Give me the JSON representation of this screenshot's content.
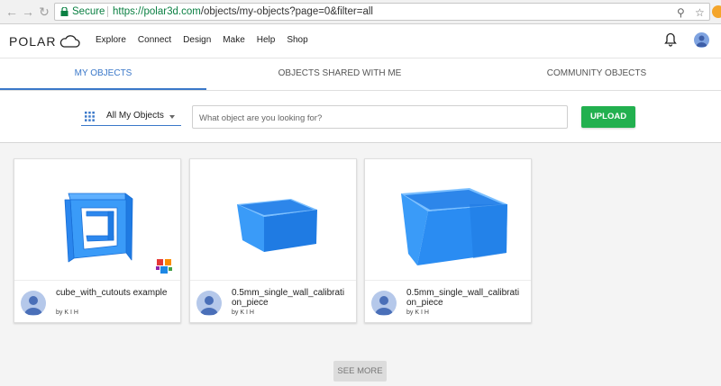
{
  "browser": {
    "secure_label": "Secure",
    "url_host": "https://polar3d.com",
    "url_path": "/objects/my-objects?page=0&filter=all"
  },
  "header": {
    "logo_text": "POLAR",
    "nav": [
      "Explore",
      "Connect",
      "Design",
      "Make",
      "Help",
      "Shop"
    ]
  },
  "tabs": [
    {
      "label": "MY OBJECTS",
      "active": true
    },
    {
      "label": "OBJECTS SHARED WITH ME",
      "active": false
    },
    {
      "label": "COMMUNITY OBJECTS",
      "active": false
    }
  ],
  "filter": {
    "selected": "All My Objects",
    "search_placeholder": "What object are you looking for?",
    "upload_label": "UPLOAD"
  },
  "objects": [
    {
      "title": "cube_with_cutouts example",
      "author": "by K I H",
      "shape": "open-cube",
      "badge": true
    },
    {
      "title": "0.5mm_single_wall_calibration_piece",
      "author": "by K I H",
      "shape": "open-box",
      "badge": false
    },
    {
      "title": "0.5mm_single_wall_calibration_piece",
      "author": "by K I H",
      "shape": "open-box",
      "badge": false
    }
  ],
  "see_more_label": "SEE MORE",
  "colors": {
    "accent": "#3a78c9",
    "upload": "#22b04f",
    "model_blue": "#2f8ff0",
    "secure_green": "#0b8043"
  },
  "icons": [
    "back-arrow-icon",
    "forward-arrow-icon",
    "reload-icon",
    "lock-icon",
    "zoom-icon",
    "star-icon",
    "cloud-logo-icon",
    "bell-icon",
    "account-icon",
    "grid-icon",
    "chevron-down-icon",
    "user-icon",
    "remix-badge-icon"
  ]
}
